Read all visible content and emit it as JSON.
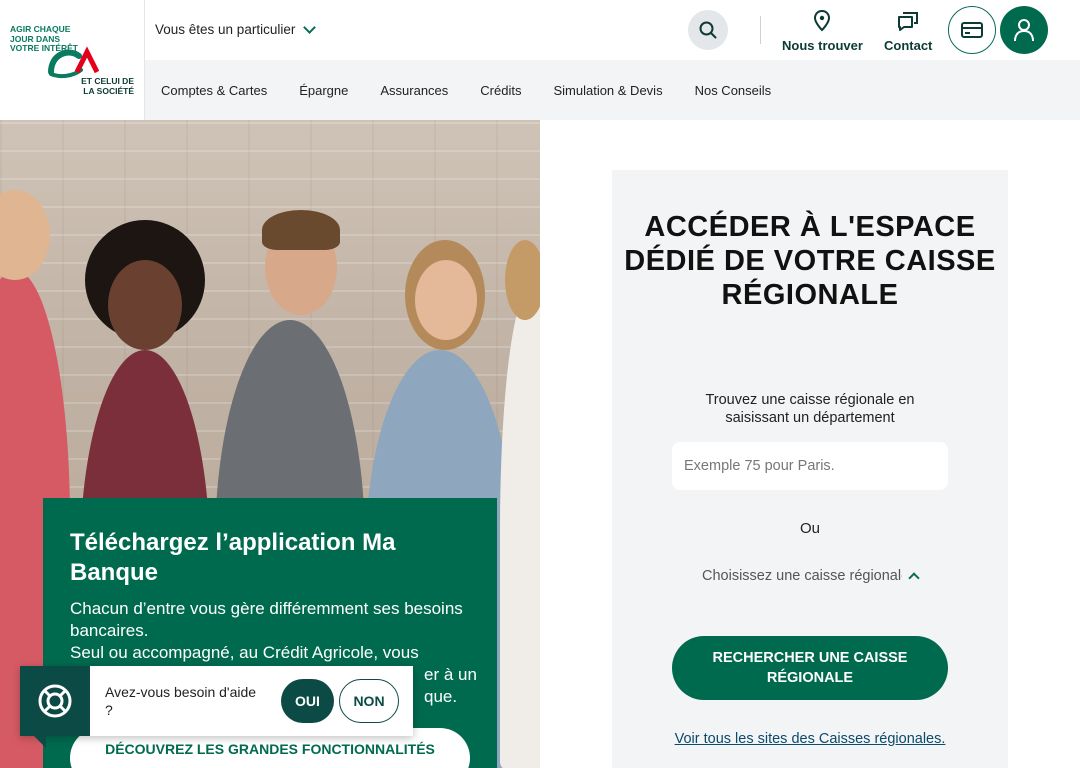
{
  "brand": {
    "tagline": "AGIR CHAQUE JOUR DANS VOTRE INTÉRÊT",
    "logo_letters": "CA",
    "sub": "ET CELUI DE LA SOCIÉTÉ",
    "colors": {
      "primary": "#006a4e",
      "dark": "#0b4a45",
      "accent_red": "#e2001a"
    }
  },
  "topbar": {
    "profile": "Vous êtes un particulier",
    "search_icon": "search-icon",
    "links": [
      {
        "label": "Nous trouver",
        "icon": "location-pin-icon"
      },
      {
        "label": "Contact",
        "icon": "chat-icon"
      }
    ],
    "card_icon": "credit-card-icon",
    "user_icon": "user-icon"
  },
  "nav": {
    "items": [
      "Comptes & Cartes",
      "Épargne",
      "Assurances",
      "Crédits",
      "Simulation & Devis",
      "Nos Conseils"
    ]
  },
  "app_promo": {
    "title": "Téléchargez l’application Ma Banque",
    "desc": "Chacun d’entre vous gère différemment ses besoins bancaires. Seul ou accompagné, au Crédit Agricole, vous pouvez vous connecter à un conseiller à un moment ou en ligne qui vous convient : sur l’application Ma Banque.",
    "desc_visible": "Chacun d’entre vous gère différemment ses besoins bancaires.\nSeul ou accompagné, au Crédit Agricole, vous",
    "desc_tail": "er à un",
    "desc_tail2": "que.",
    "button": "DÉCOUVREZ LES GRANDES FONCTIONNALITÉS"
  },
  "help": {
    "text": "Avez-vous besoin d'aide ?",
    "yes": "OUI",
    "no": "NON",
    "icon": "lifebuoy-icon"
  },
  "panel": {
    "title": "ACCÉDER À L'ESPACE DÉDIÉ DE VOTRE CAISSE RÉGIONALE",
    "subtitle": "Trouvez une caisse régionale en saisissant un département",
    "input_placeholder": "Exemple 75 pour Paris.",
    "or": "Ou",
    "select_placeholder": "Choisissez une caisse régionale",
    "search_button": "RECHERCHER UNE CAISSE RÉGIONALE",
    "all_sites_link": "Voir tous les sites des Caisses régionales."
  }
}
